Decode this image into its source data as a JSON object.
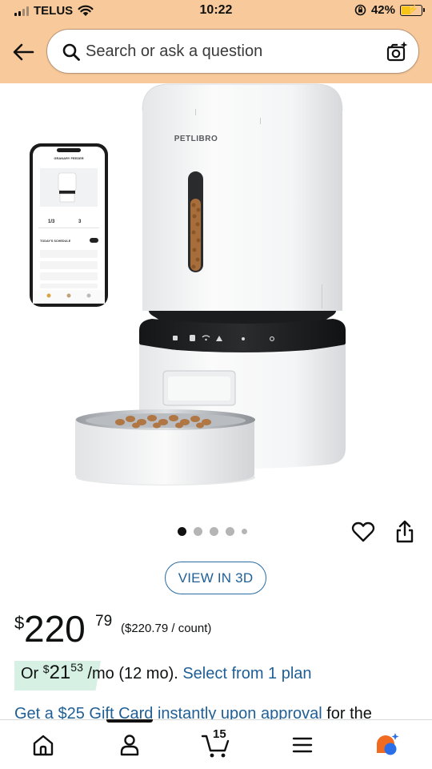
{
  "status_bar": {
    "carrier": "TELUS",
    "time": "10:22",
    "battery_percent": "42%",
    "battery_level": 0.42,
    "icons": [
      "signal-icon",
      "wifi-icon",
      "orientation-lock-icon",
      "battery-charging-icon"
    ]
  },
  "header": {
    "back_icon": "back-arrow-icon",
    "search": {
      "placeholder": "Search or ask a question",
      "value": ""
    },
    "camera_icon": "camera-search-icon",
    "background_color": "#f8c99a"
  },
  "product_image": {
    "brand_text": "PETLIBRO",
    "app_screen": {
      "title": "GRANARY FEEDER",
      "stats": [
        "1/3",
        "3"
      ],
      "section": "TODAY'S SCHEDULE"
    },
    "gallery": {
      "count": 5,
      "active_index": 0
    }
  },
  "actions": {
    "wishlist_icon": "heart-icon",
    "share_icon": "share-icon"
  },
  "view_3d": {
    "label": "VIEW IN 3D"
  },
  "price": {
    "currency": "$",
    "whole": "220",
    "fraction": "79",
    "unit_price": "($220.79 / count)"
  },
  "monthly_plan": {
    "prefix": "Or",
    "currency": "$",
    "whole": "21",
    "fraction": "53",
    "term": "/mo (12 mo).",
    "link": "Select from 1 plan",
    "badge_color": "#d6f1e3"
  },
  "gift_card": {
    "link": "Get a $25 Gift Card instantly upon approval",
    "suffix": " for the"
  },
  "bottom_nav": {
    "items": [
      {
        "name": "home",
        "icon": "home-icon"
      },
      {
        "name": "account",
        "icon": "account-icon"
      },
      {
        "name": "cart",
        "icon": "cart-icon",
        "count": "15"
      },
      {
        "name": "menu",
        "icon": "menu-icon"
      },
      {
        "name": "rufus",
        "icon": "rufus-assistant-icon"
      }
    ],
    "active_index": 1
  },
  "colors": {
    "link": "#1f5f96",
    "text": "#0f1111",
    "accent_orange": "#f06a1f",
    "accent_blue": "#2a6ee8"
  }
}
